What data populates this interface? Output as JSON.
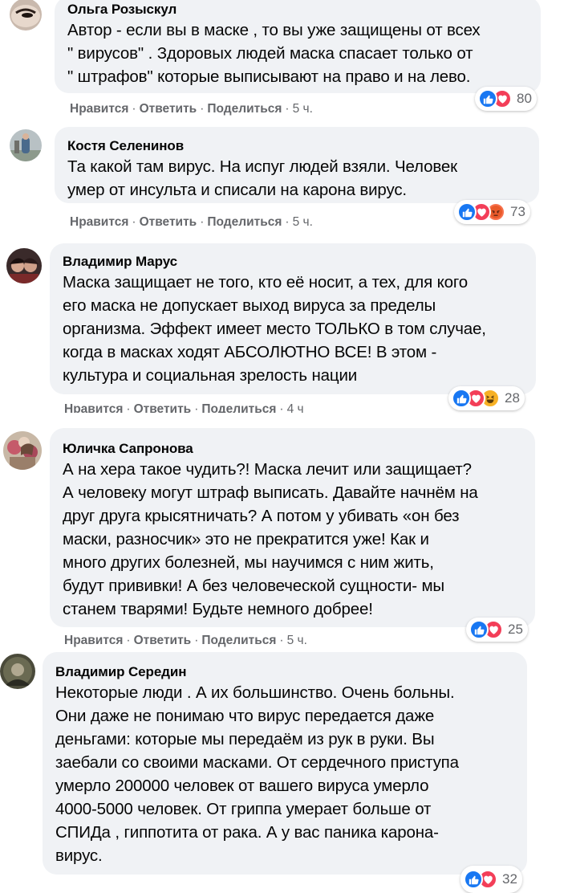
{
  "actions": {
    "like": "Нравится",
    "reply": "Ответить",
    "share": "Поделиться",
    "sep": "·"
  },
  "comments": [
    {
      "author": "Ольга Розыскул",
      "text": "Автор - если вы в маске , то вы уже защищены от всех\n\" вирусов\" . Здоровых людей маска спасает только от\n\" штрафов\" которые выписывают на право и на лево.",
      "time": "5 ч.",
      "reactions": [
        "like",
        "love"
      ],
      "count": "80"
    },
    {
      "author": "Костя Селенинов",
      "text": "Та какой там вирус. На испуг людей взяли. Человек\nумер от инсульта и списали на карона вирус.",
      "time": "5 ч.",
      "reactions": [
        "like",
        "love",
        "angry"
      ],
      "count": "73"
    },
    {
      "author": "Владимир Марус",
      "text": "Маска защищает не того, кто её носит, а тех, для кого\nего маска не допускает выход вируса за пределы\nорганизма. Эффект имеет место ТОЛЬКО в том случае,\nкогда в масках ходят АБСОЛЮТНО ВСЕ! В этом -\nкультура и социальная зрелость нации",
      "time": "4 ч",
      "reactions": [
        "like",
        "love",
        "haha"
      ],
      "count": "28"
    },
    {
      "author": "Юличка Сапронова",
      "text": "А на хера такое чудить?! Маска лечит или защищает?\nА человеку могут штраф выписать. Давайте начнём на\nдруг друга крысятничать? А потом у убивать «он без\nмаски, разносчик» это не прекратится уже! Как и\nмного других болезней, мы научимся с ним жить,\nбудут прививки! А без человеческой сущности- мы\nстанем тварями! Будьте немного добрее!",
      "time": "5 ч.",
      "reactions": [
        "like",
        "love"
      ],
      "count": "25"
    },
    {
      "author": "Владимир Середин",
      "text": "Некоторые люди . А их большинство. Очень больны.\nОни даже не понимаю что вирус передается даже\nденьгами: которые мы передаём из рук в руки. Вы\nзаебали со своими масками. От сердечного приступа\nумерло 200000 человек от вашего вируса умерло\n4000-5000 человек. От гриппа умерает больше от\nСПИДа , гиппотита от рака. А у вас паника карона-\nвирус.",
      "time": "",
      "reactions": [
        "like",
        "love"
      ],
      "count": "32"
    }
  ],
  "colors": {
    "bubble": "#f0f2f5",
    "meta": "#65676b",
    "like": "#1877f2",
    "love": "#f33e58",
    "angry": "#f7714c",
    "haha": "#f7b125"
  }
}
